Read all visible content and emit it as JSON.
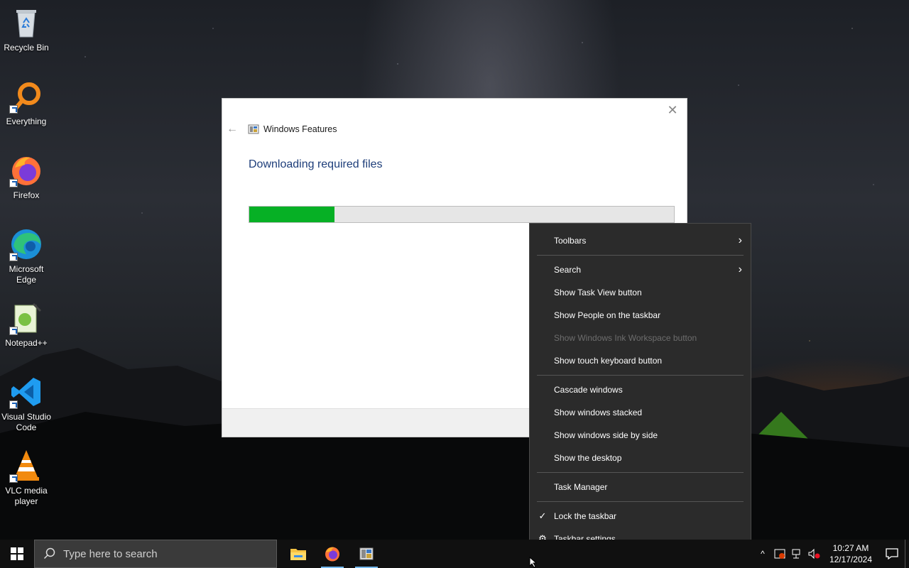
{
  "desktop": {
    "icons": [
      {
        "label": "Recycle Bin"
      },
      {
        "label": "Everything"
      },
      {
        "label": "Firefox"
      },
      {
        "label": "Microsoft Edge"
      },
      {
        "label": "Notepad++"
      },
      {
        "label": "Visual Studio Code"
      },
      {
        "label": "VLC media player"
      }
    ]
  },
  "dialog": {
    "title": "Windows Features",
    "heading": "Downloading required files",
    "progress_fraction": 0.2,
    "close_glyph": "✕",
    "back_glyph": "←"
  },
  "context_menu": {
    "items": [
      {
        "label": "Toolbars",
        "submenu": true
      },
      {
        "label": "Search",
        "submenu": true
      },
      {
        "label": "Show Task View button"
      },
      {
        "label": "Show People on the taskbar"
      },
      {
        "label": "Show Windows Ink Workspace button",
        "disabled": true
      },
      {
        "label": "Show touch keyboard button"
      },
      {
        "label": "Cascade windows"
      },
      {
        "label": "Show windows stacked"
      },
      {
        "label": "Show windows side by side"
      },
      {
        "label": "Show the desktop"
      },
      {
        "label": "Task Manager"
      },
      {
        "label": "Lock the taskbar",
        "checked": true
      },
      {
        "label": "Taskbar settings",
        "icon": "gear-icon"
      }
    ]
  },
  "taskbar": {
    "search_placeholder": "Type here to search",
    "apps": [
      {
        "name": "file-explorer-icon"
      },
      {
        "name": "firefox-icon",
        "active": true
      },
      {
        "name": "windows-features-icon",
        "active": true
      }
    ],
    "clock": {
      "time": "10:27 AM",
      "date": "12/17/2024"
    }
  },
  "colors": {
    "progress_fill": "#06b025",
    "heading": "#1e3e7a",
    "menu_bg": "#2b2b2b"
  }
}
